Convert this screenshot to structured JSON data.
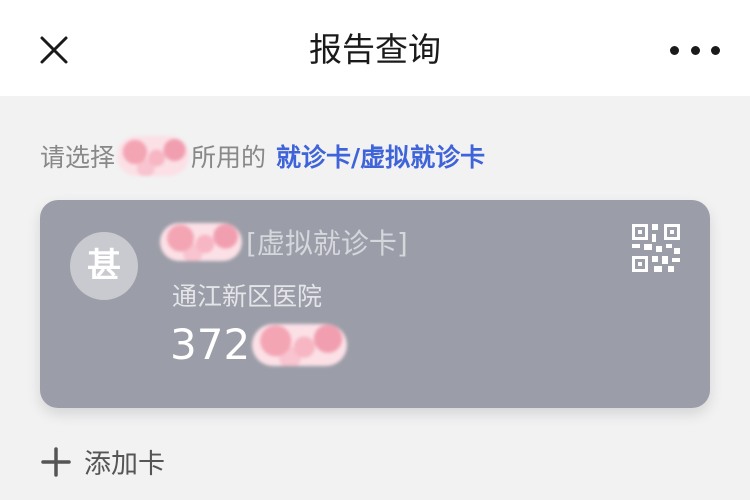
{
  "header": {
    "title": "报告查询",
    "close_icon": "close-icon",
    "more_icon": "more-dots-icon"
  },
  "prompt": {
    "prefix": "请选择",
    "suffix": "所用的",
    "link": "就诊卡/虚拟就诊卡"
  },
  "card": {
    "avatar_char": "甚",
    "card_type": "[虚拟就诊卡]",
    "hospital": "通江新区医院",
    "number_prefix": "372",
    "qr_icon": "qr-code-icon"
  },
  "add_card": {
    "label": "添加卡",
    "icon": "plus-icon"
  },
  "colors": {
    "link": "#3f63d8",
    "card_bg": "#9b9ea8",
    "page_bg": "#f2f2f3"
  }
}
